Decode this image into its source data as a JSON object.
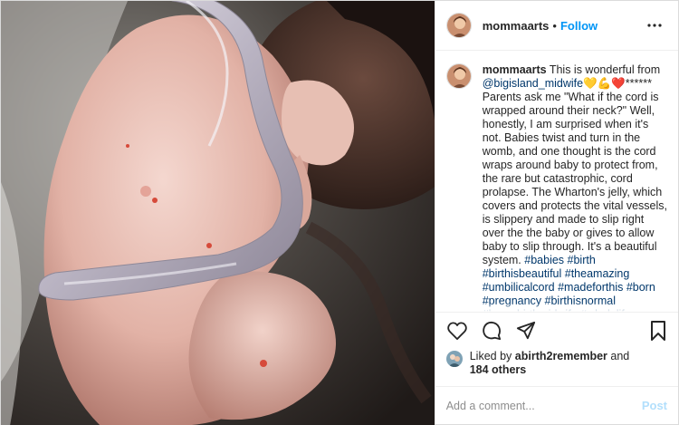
{
  "post": {
    "image_alt": "newborn baby with umbilical cord",
    "author": {
      "username": "mommaarts",
      "follow_label": "Follow",
      "separator": "•"
    },
    "caption": {
      "username": "mommaarts",
      "intro": "This is wonderful from",
      "mention": "@bigisland_midwife",
      "emoji": "💛💪❤️",
      "stars": "******",
      "body": "Parents ask me \"What if the cord is wrapped around their neck?\" Well, honestly, I am surprised when it's not. Babies twist and turn in the womb, and one thought is the cord wraps around baby to protect from, the rare but catastrophic, cord prolapse. The Wharton's jelly, which covers and protects the vital vessels, is slippery and made to slip right over the the baby or gives to allow baby to slip through. It's a beautiful system.",
      "hashtags": "#babies #birth #birthisbeautiful #theamazing #umbilicalcord #madeforthis #born #pregnancy #birthisnormal #homebirthmidwife #wholelife #thomorowknow #repost"
    },
    "actions": {
      "like_icon": "heart-icon",
      "comment_icon": "comment-icon",
      "share_icon": "share-icon",
      "save_icon": "bookmark-icon"
    },
    "likes": {
      "prefix": "Liked by",
      "user": "abirth2remember",
      "conjunction": "and",
      "others": "184 others"
    },
    "comment_box": {
      "placeholder": "Add a comment...",
      "post_label": "Post"
    },
    "colors": {
      "accent": "#0095f6",
      "link": "#00376b",
      "post_disabled": "#b2dffc",
      "text": "#262626",
      "muted": "#8e8e8e"
    }
  }
}
